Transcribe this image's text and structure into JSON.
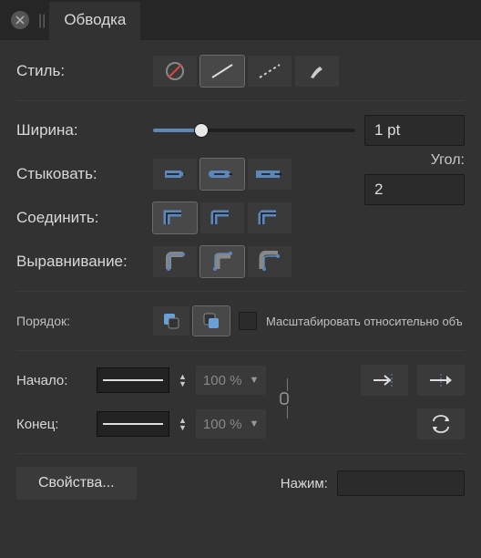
{
  "tab": {
    "title": "Обводка"
  },
  "labels": {
    "style": "Стиль:",
    "width": "Ширина:",
    "cap": "Стыковать:",
    "join": "Соединить:",
    "align": "Выравнивание:",
    "order": "Порядок:",
    "start": "Начало:",
    "end": "Конец:",
    "props_btn": "Свойства...",
    "pressure": "Нажим:",
    "miter": "Угол:",
    "scale": "Масштабировать относительно объ"
  },
  "values": {
    "width_text": "1 pt",
    "width_pct": 24,
    "miter": "2",
    "start_scale": "100 %",
    "end_scale": "100 %"
  },
  "selected": {
    "style": 1,
    "cap": 1,
    "join": 0,
    "align": 1,
    "order": 1
  }
}
